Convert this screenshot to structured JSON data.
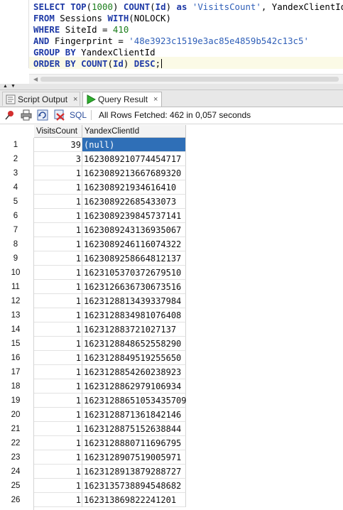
{
  "editor": {
    "lines": [
      {
        "parts": [
          [
            "kw",
            "SELECT"
          ],
          [
            "t",
            " "
          ],
          [
            "kw",
            "TOP"
          ],
          [
            "t",
            "("
          ],
          [
            "num",
            "1000"
          ],
          [
            "t",
            ") "
          ],
          [
            "kw",
            "COUNT"
          ],
          [
            "t",
            "("
          ],
          [
            "kw",
            "Id"
          ],
          [
            "t",
            ") "
          ],
          [
            "kw",
            "as"
          ],
          [
            "t",
            " "
          ],
          [
            "str",
            "'VisitsCount'"
          ],
          [
            "t",
            ", YandexClientId"
          ]
        ]
      },
      {
        "parts": [
          [
            "kw",
            "FROM"
          ],
          [
            "t",
            " Sessions "
          ],
          [
            "kw",
            "WITH"
          ],
          [
            "t",
            "(NOLOCK)"
          ]
        ]
      },
      {
        "parts": [
          [
            "kw",
            "WHERE"
          ],
          [
            "t",
            " SiteId = "
          ],
          [
            "num",
            "410"
          ]
        ]
      },
      {
        "parts": [
          [
            "kw",
            "AND"
          ],
          [
            "t",
            " Fingerprint = "
          ],
          [
            "str",
            "'48e3923c1519e3ac85e4859b542c13c5'"
          ]
        ]
      },
      {
        "parts": [
          [
            "kw",
            "GROUP BY"
          ],
          [
            "t",
            " YandexClientId"
          ]
        ]
      },
      {
        "parts": [
          [
            "kw",
            "ORDER BY"
          ],
          [
            "t",
            " "
          ],
          [
            "kw",
            "COUNT"
          ],
          [
            "t",
            "("
          ],
          [
            "kw",
            "Id"
          ],
          [
            "t",
            ") "
          ],
          [
            "kw",
            "DESC"
          ],
          [
            "t",
            ";"
          ]
        ]
      }
    ]
  },
  "tabs": {
    "script_output": "Script Output",
    "query_result": "Query Result",
    "close_glyph": "×"
  },
  "toolbar": {
    "sql_label": "SQL",
    "fetch_status": "All Rows Fetched: 462 in 0,057 seconds"
  },
  "grid": {
    "columns": [
      "VisitsCount",
      "YandexClientId"
    ],
    "rows": [
      {
        "n": "1",
        "visits": "39",
        "client": "(null)"
      },
      {
        "n": "2",
        "visits": "3",
        "client": "1623089210774454717"
      },
      {
        "n": "3",
        "visits": "1",
        "client": "1623089213667689320"
      },
      {
        "n": "4",
        "visits": "1",
        "client": "162308921934616410"
      },
      {
        "n": "5",
        "visits": "1",
        "client": "162308922685433073"
      },
      {
        "n": "6",
        "visits": "1",
        "client": "1623089239845737141"
      },
      {
        "n": "7",
        "visits": "1",
        "client": "1623089243136935067"
      },
      {
        "n": "8",
        "visits": "1",
        "client": "1623089246116074322"
      },
      {
        "n": "9",
        "visits": "1",
        "client": "1623089258664812137"
      },
      {
        "n": "10",
        "visits": "1",
        "client": "1623105370372679510"
      },
      {
        "n": "11",
        "visits": "1",
        "client": "1623126636730673516"
      },
      {
        "n": "12",
        "visits": "1",
        "client": "1623128813439337984"
      },
      {
        "n": "13",
        "visits": "1",
        "client": "1623128834981076408"
      },
      {
        "n": "14",
        "visits": "1",
        "client": "162312883721027137"
      },
      {
        "n": "15",
        "visits": "1",
        "client": "1623128848652558290"
      },
      {
        "n": "16",
        "visits": "1",
        "client": "1623128849519255650"
      },
      {
        "n": "17",
        "visits": "1",
        "client": "1623128854260238923"
      },
      {
        "n": "18",
        "visits": "1",
        "client": "1623128862979106934"
      },
      {
        "n": "19",
        "visits": "1",
        "client": "16231288651053435709"
      },
      {
        "n": "20",
        "visits": "1",
        "client": "1623128871361842146"
      },
      {
        "n": "21",
        "visits": "1",
        "client": "1623128875152638844"
      },
      {
        "n": "22",
        "visits": "1",
        "client": "1623128880711696795"
      },
      {
        "n": "23",
        "visits": "1",
        "client": "1623128907519005971"
      },
      {
        "n": "24",
        "visits": "1",
        "client": "1623128913879288727"
      },
      {
        "n": "25",
        "visits": "1",
        "client": "1623135738894548682"
      },
      {
        "n": "26",
        "visits": "1",
        "client": "162313869822241201"
      }
    ]
  },
  "icons": {
    "pin": "pin-icon",
    "print": "print-icon",
    "refresh": "refresh-icon",
    "clear": "clear-icon",
    "run": "run-icon",
    "script": "script-icon"
  },
  "colors": {
    "keyword": "#1f3aa6",
    "number": "#1a7d1a",
    "string": "#2f5fb8",
    "selection": "#2f6fb7"
  }
}
